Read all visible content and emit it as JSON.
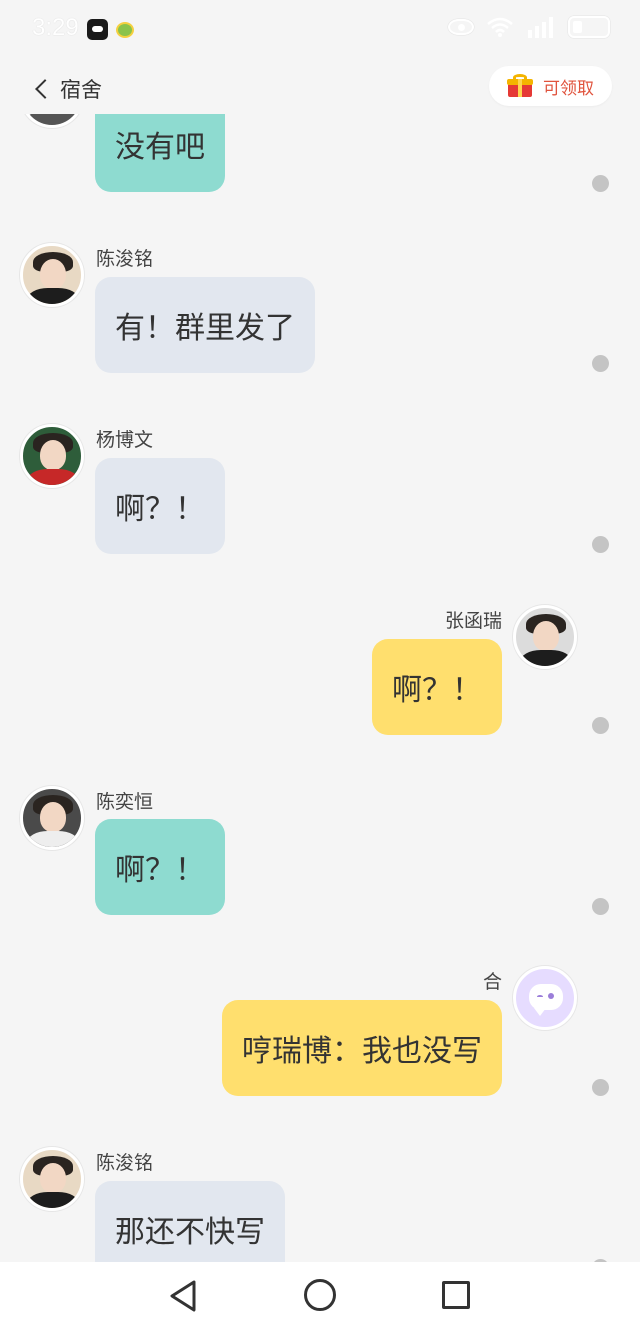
{
  "status_bar": {
    "time": "3:29",
    "icons": [
      "app-badge-icon",
      "app-badge-icon-2",
      "eye-icon",
      "wifi-icon",
      "signal-icon",
      "battery-icon"
    ]
  },
  "header": {
    "title": "宿舍",
    "reward_label": "可领取",
    "reward_icon": "gift-icon"
  },
  "messages": [
    {
      "sender": "",
      "text": "没有吧",
      "side": "left",
      "bubble_color": "#8edbd0"
    },
    {
      "sender": "陈浚铭",
      "text": "有！群里发了",
      "side": "left",
      "bubble_color": "#e2e7ef"
    },
    {
      "sender": "杨博文",
      "text": "啊？！",
      "side": "left",
      "bubble_color": "#e2e7ef"
    },
    {
      "sender": "张函瑞",
      "text": "啊？！",
      "side": "right",
      "bubble_color": "#ffdf6e"
    },
    {
      "sender": "陈奕恒",
      "text": "啊？！",
      "side": "left",
      "bubble_color": "#8edbd0"
    },
    {
      "sender": "合",
      "text": "哼瑞博：我也没写",
      "side": "right",
      "bubble_color": "#ffdf6e"
    },
    {
      "sender": "陈浚铭",
      "text": "那还不快写",
      "side": "left",
      "bubble_color": "#e2e7ef"
    }
  ],
  "nav": {
    "back_icon": "triangle-back-icon",
    "home_icon": "circle-home-icon",
    "recent_icon": "square-recent-icon"
  }
}
